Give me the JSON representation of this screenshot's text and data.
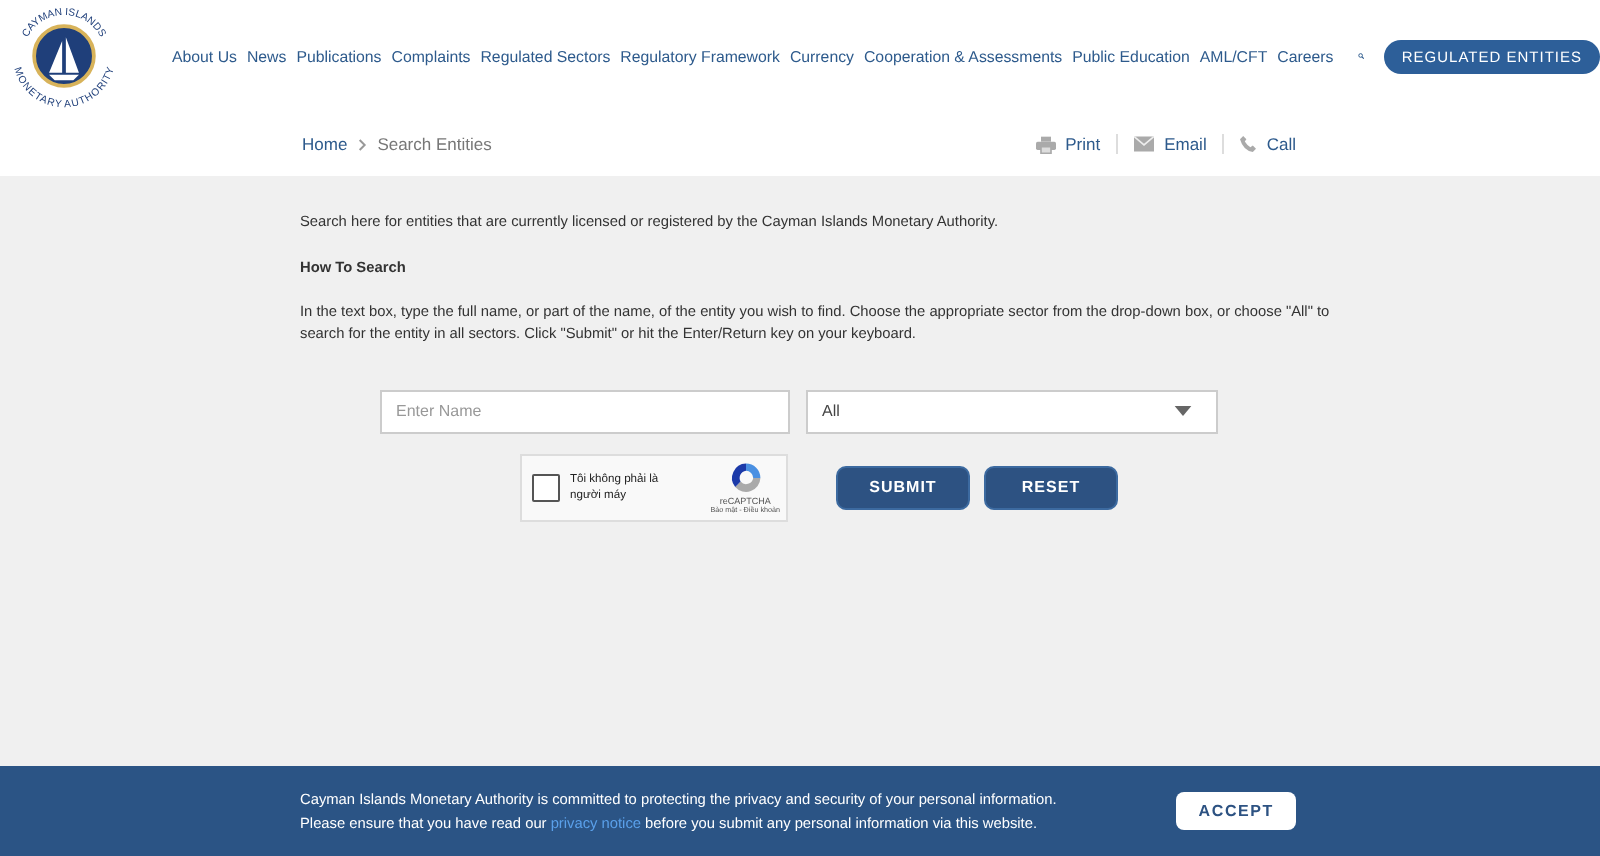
{
  "logo": {
    "top_text": "CAYMAN ISLANDS",
    "bottom_text": "MONETARY AUTHORITY"
  },
  "nav": [
    "About Us",
    "News",
    "Publications",
    "Complaints",
    "Regulated Sectors",
    "Regulatory Framework",
    "Currency",
    "Cooperation & Assessments",
    "Public Education",
    "AML/CFT",
    "Careers"
  ],
  "cta": "REGULATED ENTITIES",
  "breadcrumb": [
    "Home",
    "Search Entities"
  ],
  "actions": [
    {
      "kind": "print",
      "label": "Print"
    },
    {
      "kind": "email",
      "label": "Email"
    },
    {
      "kind": "call",
      "label": "Call"
    }
  ],
  "intro": "Search here for entities that are currently licensed or registered by the Cayman Islands Monetary Authority.",
  "how_title": "How To Search",
  "how_text": "In the text box, type the full name, or part of the name, of the entity you wish to find. Choose the appropriate sector from the drop-down box, or choose \"All\" to search for the entity in all sectors. Click \"Submit\" or hit the Enter/Return key on your keyboard.",
  "name_field": {
    "placeholder": "Enter Name"
  },
  "sector": {
    "value": "All"
  },
  "captcha": {
    "checked": false,
    "label": "Tôi không phải là người máy",
    "brand": "reCAPTCHA",
    "links": "Bảo mật - Điều khoản"
  },
  "buttons": [
    "SUBMIT",
    "RESET"
  ],
  "notice": {
    "line1": "Cayman Islands Monetary Authority is committed to protecting the privacy and security of your personal information.",
    "line2_before": "Please ensure that you have read our",
    "link": "privacy notice",
    "line2_after": "before you submit any personal information via this website.",
    "accept": "ACCEPT"
  }
}
